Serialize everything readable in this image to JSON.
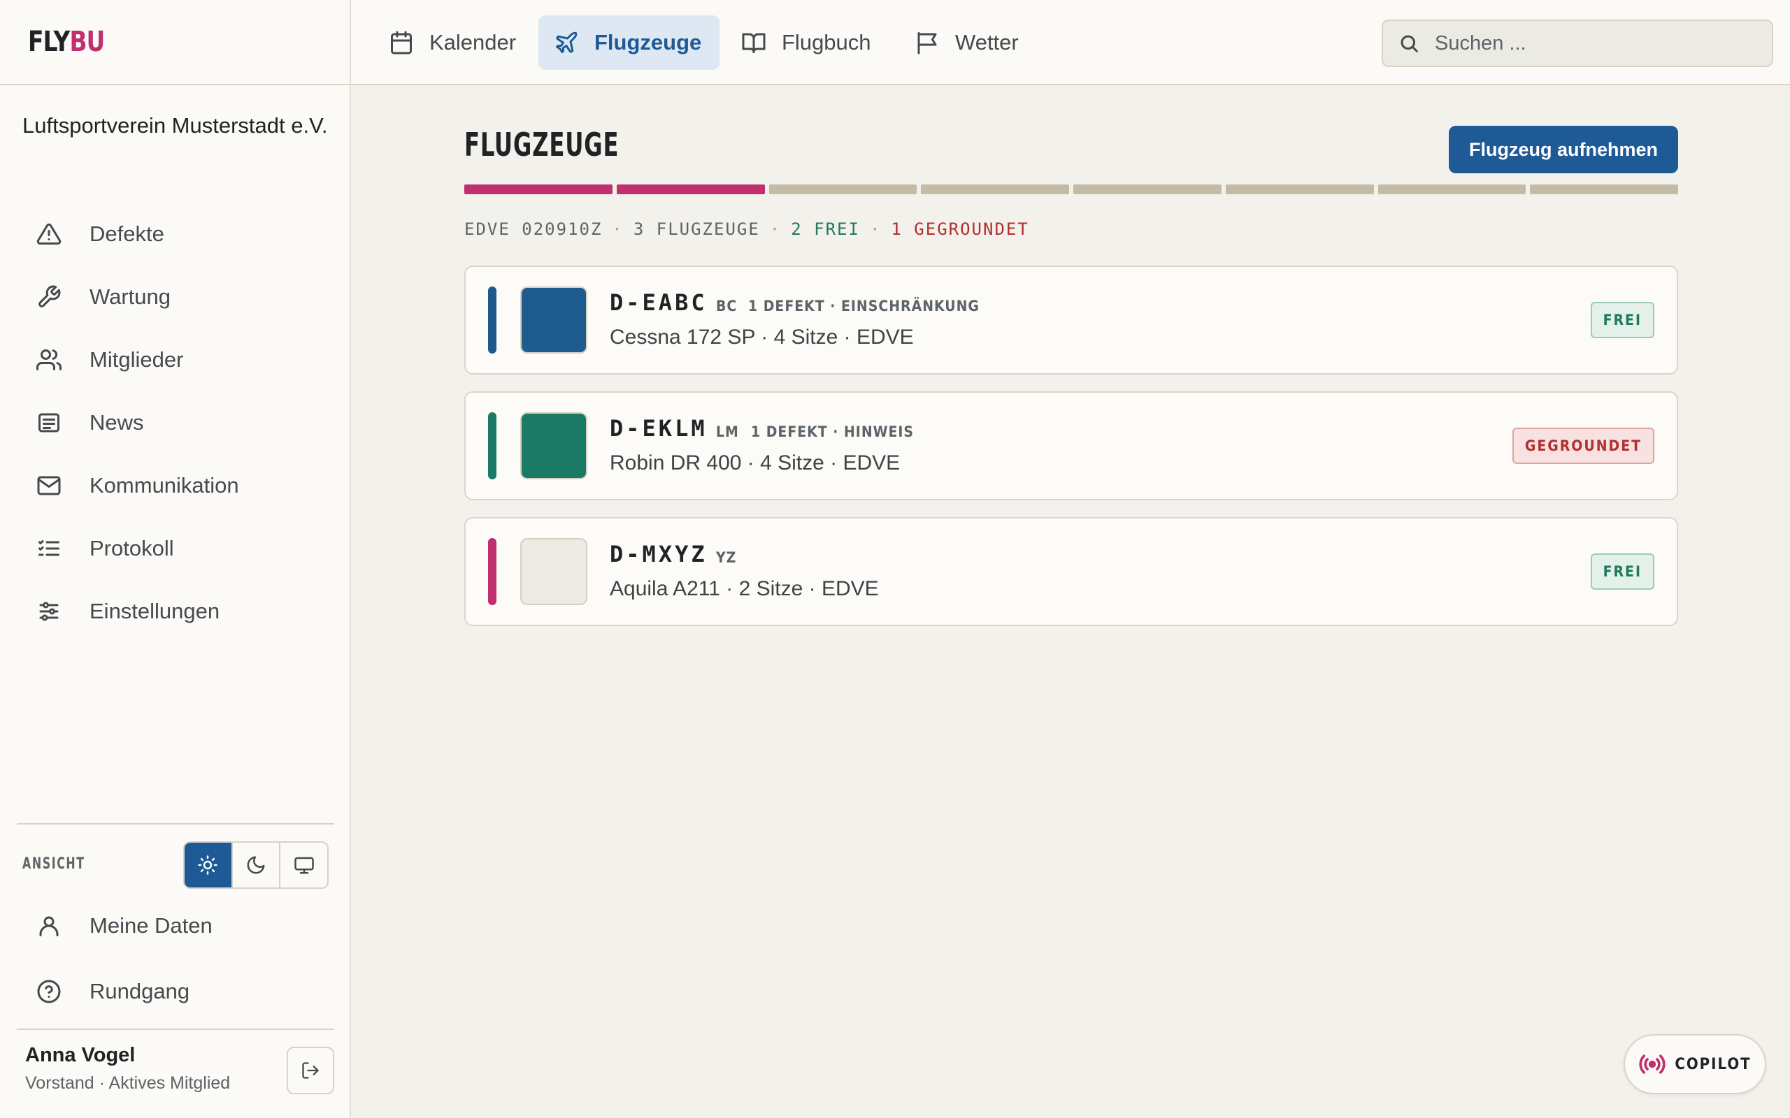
{
  "brand": {
    "part1": "FLY",
    "part2": "BU",
    "accent": "#c0306e"
  },
  "sidebar": {
    "org_name": "Luftsportverein Musterstadt e.V.",
    "items": [
      {
        "label": "Defekte",
        "icon": "warning-icon"
      },
      {
        "label": "Wartung",
        "icon": "wrench-icon"
      },
      {
        "label": "Mitglieder",
        "icon": "users-icon"
      },
      {
        "label": "News",
        "icon": "newspaper-icon"
      },
      {
        "label": "Kommunikation",
        "icon": "mail-icon"
      },
      {
        "label": "Protokoll",
        "icon": "list-icon"
      },
      {
        "label": "Einstellungen",
        "icon": "sliders-icon"
      }
    ],
    "view_label": "ANSICHT",
    "theme_options": [
      "light",
      "dark",
      "system"
    ],
    "theme_selected": "light",
    "my_data_label": "Meine Daten",
    "tour_label": "Rundgang",
    "user": {
      "name": "Anna Vogel",
      "role": "Vorstand · Aktives Mitglied"
    }
  },
  "topbar": {
    "tabs": [
      {
        "label": "Kalender",
        "icon": "calendar-icon",
        "active": false
      },
      {
        "label": "Flugzeuge",
        "icon": "plane-icon",
        "active": true
      },
      {
        "label": "Flugbuch",
        "icon": "book-icon",
        "active": false
      },
      {
        "label": "Wetter",
        "icon": "flag-icon",
        "active": false
      }
    ],
    "search_placeholder": "Suchen ..."
  },
  "main": {
    "title": "FLUGZEUGE",
    "add_button": "Flugzeug aufnehmen",
    "progress": {
      "filled": 2,
      "total": 8
    },
    "meta": {
      "station": "EDVE 020910Z",
      "count": "3 FLUGZEUGE",
      "free": "2 FREI",
      "grounded": "1 GEGROUNDET"
    },
    "aircraft": [
      {
        "registration": "D-EABC",
        "code": "BC",
        "defect": "1 DEFEKT · EINSCHRÄNKUNG",
        "description": "Cessna 172 SP · 4 Sitze · EDVE",
        "status": "FREI",
        "stripe_color": "#1e5a8c",
        "swatch_color": "#1f5c8e"
      },
      {
        "registration": "D-EKLM",
        "code": "LM",
        "defect": "1 DEFEKT · HINWEIS",
        "description": "Robin DR 400 · 4 Sitze · EDVE",
        "status": "GEGROUNDET",
        "stripe_color": "#1a7a66",
        "swatch_color": "#1a7a66"
      },
      {
        "registration": "D-MXYZ",
        "code": "YZ",
        "defect": "",
        "description": "Aquila A211 · 2 Sitze · EDVE",
        "status": "FREI",
        "stripe_color": "#c0306e",
        "swatch_color": "#ecebe3"
      }
    ]
  },
  "copilot_label": "COPILOT"
}
